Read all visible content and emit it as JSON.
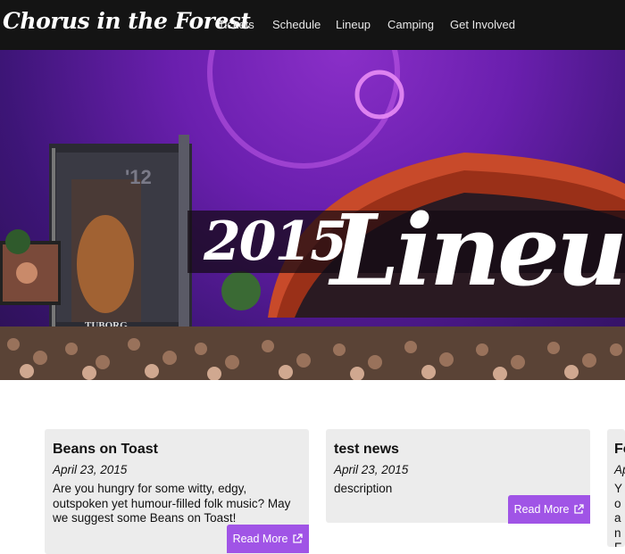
{
  "brand": "Chorus in the Forest",
  "nav": {
    "items": [
      {
        "label": "Tickets"
      },
      {
        "label": "Schedule"
      },
      {
        "label": "Lineup"
      },
      {
        "label": "Camping"
      },
      {
        "label": "Get Involved"
      }
    ]
  },
  "hero": {
    "year": "2015",
    "word": "Lineup",
    "stage_sign": "TUBORG",
    "stage_number": "'12"
  },
  "news": [
    {
      "title": "Beans on Toast",
      "date": "April 23, 2015",
      "body": "Are you hungry for some witty, edgy, outspoken yet humour-filled folk music? May we suggest some Beans on Toast!",
      "cta": "Read More"
    },
    {
      "title": "test news",
      "date": "April 23, 2015",
      "body": "description",
      "cta": "Read More"
    },
    {
      "title": "Fo",
      "date": "Ap",
      "body": "Yo an Fo"
    }
  ],
  "colors": {
    "nav_bg": "#141414",
    "accent": "#a054e6",
    "card_bg": "#ececec"
  },
  "icons": {
    "read_more": "external-link-icon"
  }
}
